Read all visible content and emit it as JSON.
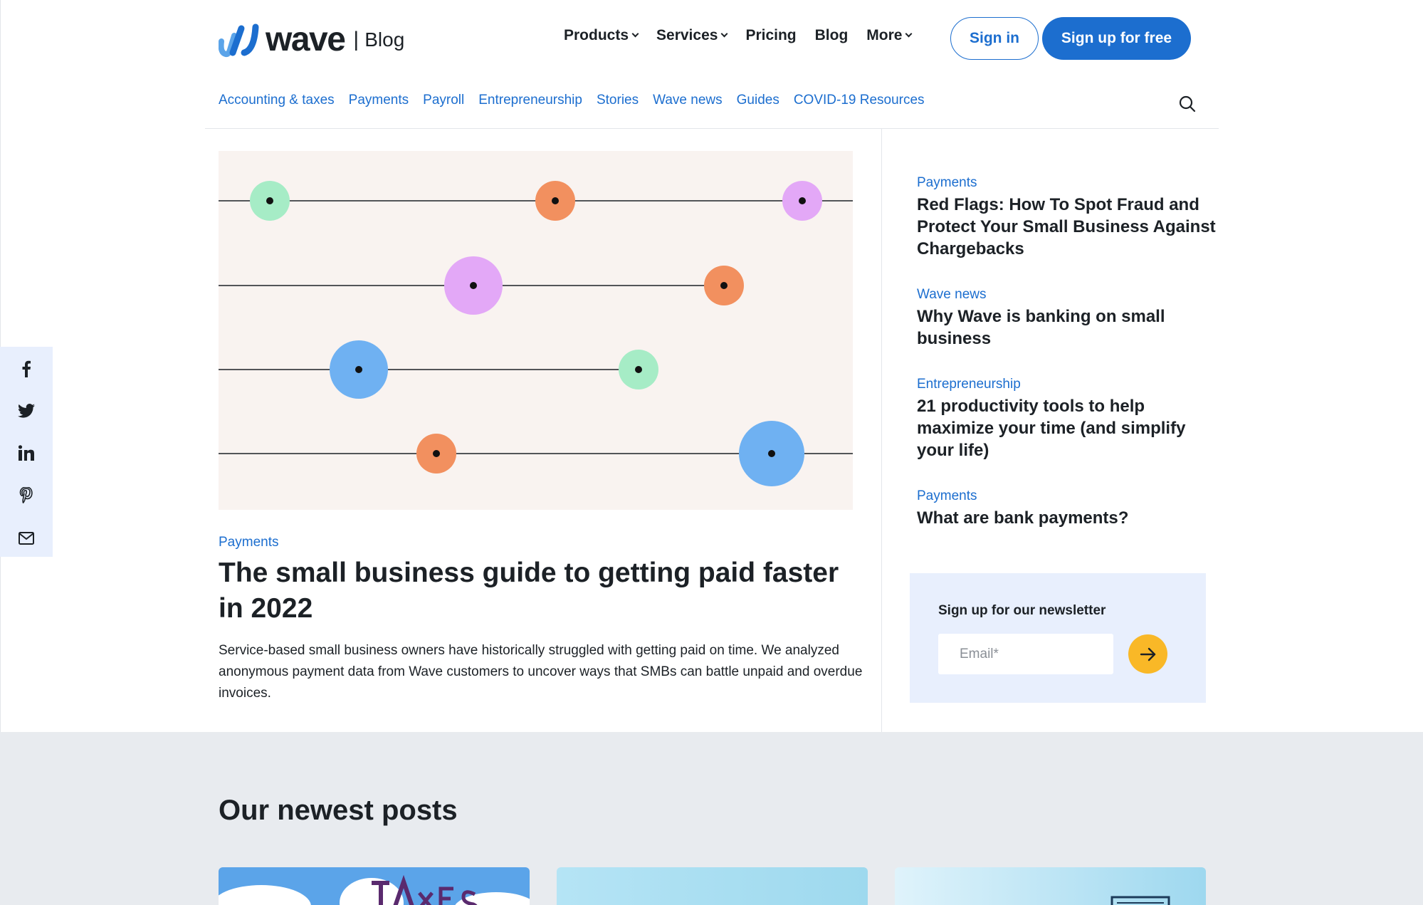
{
  "header": {
    "logo_word": "wave",
    "logo_separator": "|",
    "logo_section": "Blog",
    "nav": [
      {
        "label": "Products",
        "dropdown": true
      },
      {
        "label": "Services",
        "dropdown": true
      },
      {
        "label": "Pricing",
        "dropdown": false
      },
      {
        "label": "Blog",
        "dropdown": false
      },
      {
        "label": "More",
        "dropdown": true
      }
    ],
    "sign_in": "Sign in",
    "sign_up": "Sign up for free"
  },
  "subnav": [
    "Accounting & taxes",
    "Payments",
    "Payroll",
    "Entrepreneurship",
    "Stories",
    "Wave news",
    "Guides",
    "COVID-19 Resources"
  ],
  "share_icons": [
    "facebook-icon",
    "twitter-icon",
    "linkedin-icon",
    "pinterest-icon",
    "email-icon"
  ],
  "hero": {
    "category": "Payments",
    "title": "The small business guide to getting paid faster in 2022",
    "excerpt": "Service-based small business owners have historically struggled with getting paid on time. We analyzed anonymous payment data from Wave customers to uncover ways that SMBs can battle unpaid and overdue invoices."
  },
  "sidebar_posts": [
    {
      "category": "Payments",
      "title": "Red Flags: How To Spot Fraud and Protect Your Small Business Against Chargebacks"
    },
    {
      "category": "Wave news",
      "title": "Why Wave is banking on small business"
    },
    {
      "category": "Entrepreneurship",
      "title": "21 productivity tools to help maximize your time (and simplify your life)"
    },
    {
      "category": "Payments",
      "title": "What are bank payments?"
    }
  ],
  "newsletter": {
    "label": "Sign up for our newsletter",
    "placeholder": "Email*"
  },
  "newest": {
    "title": "Our newest posts"
  },
  "colors": {
    "brand_blue": "#1c6ecf",
    "accent_yellow": "#f9b827",
    "green_dot": "#a6ecc6",
    "orange_dot": "#f2905f",
    "purple_dot": "#e3a8f7",
    "blue_dot": "#6fb1f2"
  }
}
